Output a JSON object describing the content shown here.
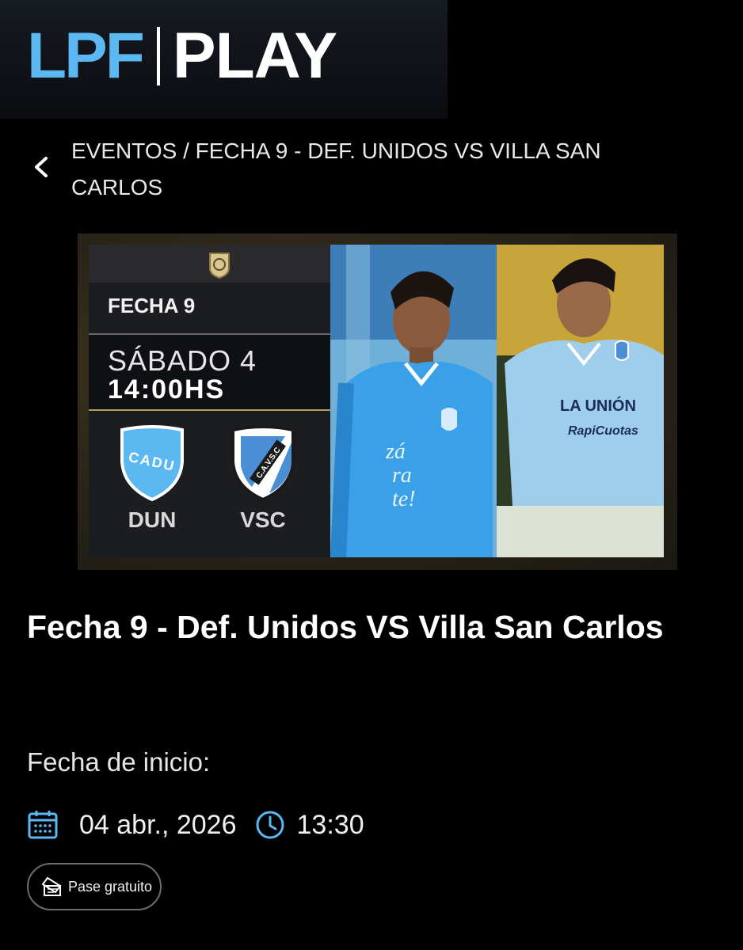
{
  "header": {
    "logo_left": "LPF",
    "logo_right": "PLAY"
  },
  "breadcrumb": {
    "text": "EVENTOS / FECHA 9 - DEF. UNIDOS VS VILLA SAN CARLOS",
    "back_icon": "chevron-left-icon"
  },
  "banner": {
    "round": "FECHA 9",
    "day": "SÁBADO 4",
    "time": "14:00HS",
    "home": {
      "abbr": "DUN",
      "crest_text": "CADU",
      "color": "#5cb8f0"
    },
    "away": {
      "abbr": "VSC",
      "crest_text": "C.A.V.S.C",
      "color": "#4a8fd6"
    }
  },
  "event": {
    "title": "Fecha 9 - Def. Unidos VS Villa San Carlos",
    "start_label": "Fecha de inicio:",
    "date": "04 abr., 2026",
    "time": "13:30",
    "date_icon": "calendar-icon",
    "time_icon": "clock-icon"
  },
  "pass": {
    "label": "Pase gratuito",
    "icon": "ticket-icon"
  },
  "colors": {
    "accent": "#5cb8f0",
    "background": "#000000",
    "gold": "#b89a58"
  }
}
